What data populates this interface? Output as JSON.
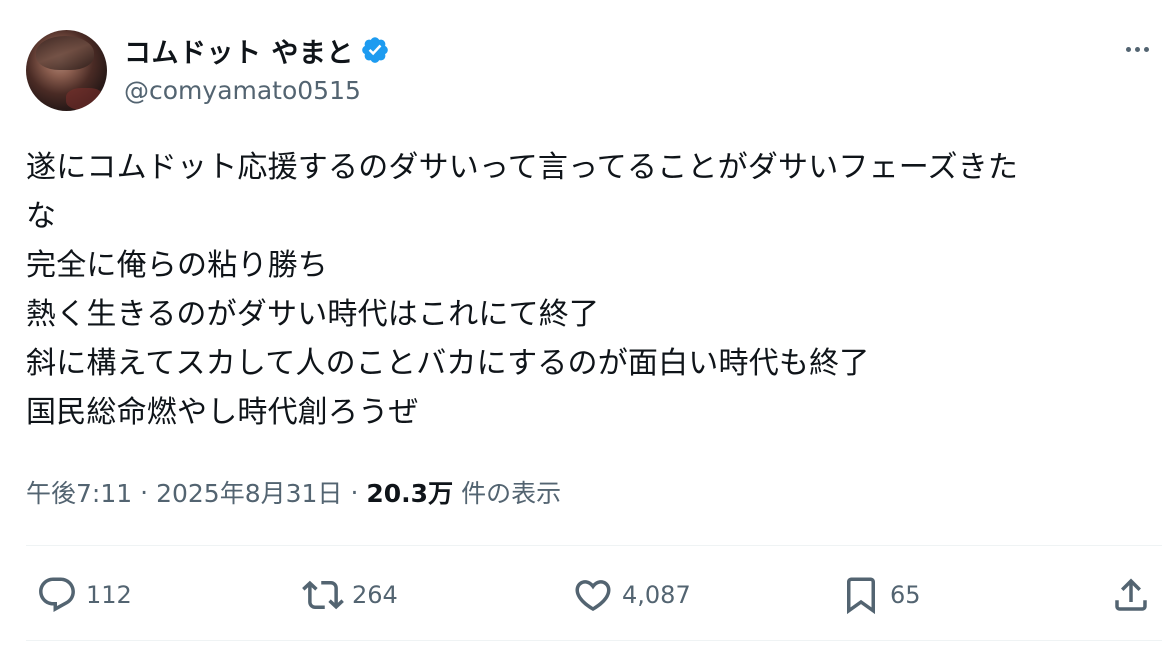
{
  "user": {
    "display_name": "コムドット やまと",
    "handle": "@comyamato0515",
    "verified": true,
    "verified_color": "#1d9bf0"
  },
  "tweet": {
    "lines": [
      "遂にコムドット応援するのダサいって言ってることがダサいフェーズきた",
      "な",
      "完全に俺らの粘り勝ち",
      "熱く生きるのがダサい時代はこれにて終了",
      "斜に構えてスカして人のことバカにするのが面白い時代も終了",
      "国民総命燃やし時代創ろうぜ"
    ]
  },
  "meta": {
    "time": "午後7:11",
    "separator": "·",
    "date": "2025年8月31日",
    "views_count": "20.3万",
    "views_label": "件の表示"
  },
  "actions": {
    "reply_count": "112",
    "retweet_count": "264",
    "like_count": "4,087",
    "bookmark_count": "65"
  },
  "icons": {
    "more": "more-horizontal-icon",
    "verified": "verified-badge-icon",
    "reply": "reply-bubble-icon",
    "retweet": "retweet-arrows-icon",
    "like": "heart-icon",
    "bookmark": "bookmark-icon",
    "share": "share-upload-icon"
  },
  "colors": {
    "text": "#0f1419",
    "secondary": "#536471",
    "divider": "#eff3f4"
  }
}
